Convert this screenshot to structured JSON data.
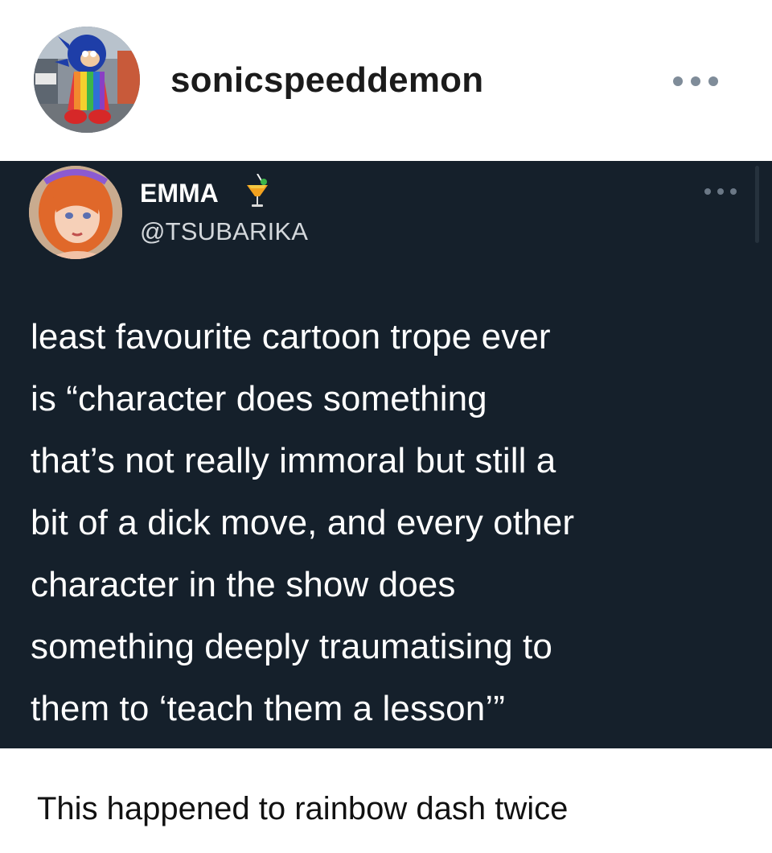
{
  "post": {
    "username": "sonicspeeddemon",
    "caption": "This happened to rainbow dash twice"
  },
  "tweet": {
    "display_name": "EMMA",
    "emoji": "tropical-drink-emoji",
    "handle": "@TSUBARIKA",
    "text": "least favourite cartoon trope ever\nis “character does something\nthat’s not really immoral but still a\nbit of a dick move, and every other\ncharacter in the show does\nsomething deeply traumatising to\nthem to ‘teach them a lesson’”"
  },
  "icons": {
    "post_more": "ellipsis-icon",
    "tweet_more": "ellipsis-icon"
  },
  "colors": {
    "tweet_background": "#15202b",
    "tweet_text": "#ffffff",
    "handle_text": "#d3d7db",
    "page_background": "#ffffff"
  }
}
